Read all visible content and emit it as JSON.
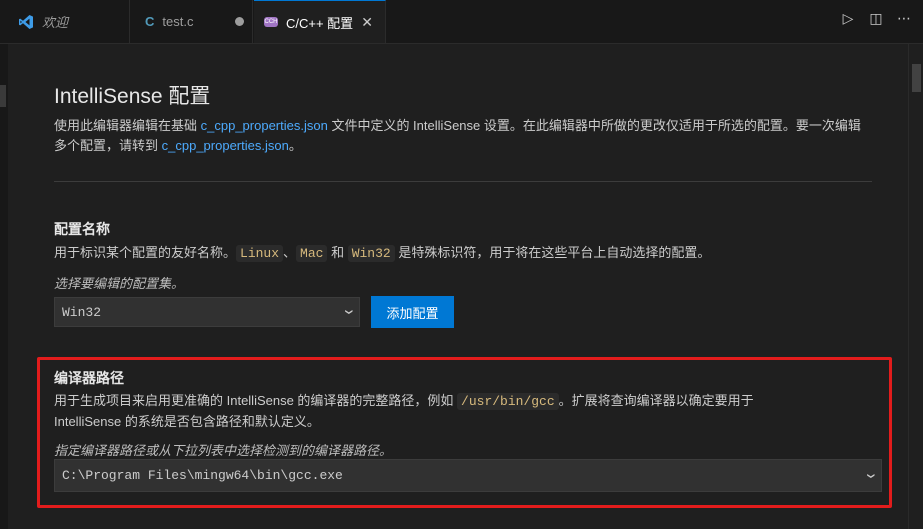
{
  "tabs": [
    {
      "label": "欢迎",
      "icon": "vscode-logo-icon"
    },
    {
      "label": "test.c",
      "icon": "c-file-icon",
      "icon_text": "C",
      "modified": true
    },
    {
      "label": "C/C++ 配置",
      "icon": "cpp-config-icon",
      "icon_text": "CCH",
      "active": true
    }
  ],
  "editor_actions": {
    "run": "▷",
    "split": "◫",
    "more": "⋯"
  },
  "page": {
    "title": "IntelliSense 配置",
    "desc_before": "使用此编辑器编辑在基础 ",
    "desc_link1": "c_cpp_properties.json",
    "desc_mid": " 文件中定义的 IntelliSense 设置。在此编辑器中所做的更改仅适用于所选的配置。要一次编辑多个配置，请转到 ",
    "desc_link2": "c_cpp_properties.json",
    "desc_after": "。"
  },
  "config_name": {
    "title": "配置名称",
    "desc_before": "用于标识某个配置的友好名称。",
    "code1": "Linux",
    "sep1": "、",
    "code2": "Mac",
    "sep2": " 和 ",
    "code3": "Win32",
    "desc_after": " 是特殊标识符，用于将在这些平台上自动选择的配置。",
    "hint": "选择要编辑的配置集。",
    "selected": "Win32",
    "add_button": "添加配置"
  },
  "compiler_path": {
    "title": "编译器路径",
    "desc_before": "用于生成项目来启用更准确的 IntelliSense 的编译器的完整路径，例如 ",
    "code": "/usr/bin/gcc",
    "desc_after": "。扩展将查询编译器以确定要用于 IntelliSense 的系统是否包含路径和默认定义。",
    "hint": "指定编译器路径或从下拉列表中选择检测到的编译器路径。",
    "value": "C:\\Program Files\\mingw64\\bin\\gcc.exe"
  },
  "colors": {
    "accent": "#0078d4",
    "highlight_box": "#e21c1c",
    "link": "#4daafc"
  }
}
